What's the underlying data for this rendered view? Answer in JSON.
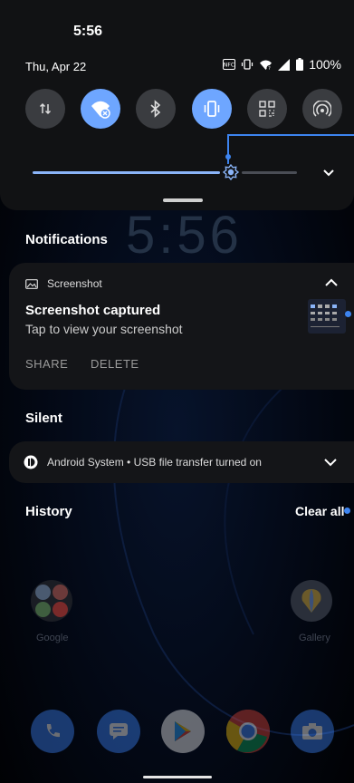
{
  "status": {
    "time": "5:56",
    "date": "Thu, Apr 22",
    "battery": "100%",
    "icons": [
      "nfc-icon",
      "vibrate-icon",
      "wifi-icon",
      "signal-icon",
      "battery-icon"
    ]
  },
  "quick_settings": {
    "tiles": [
      {
        "name": "tile-data",
        "icon": "data-arrows-icon",
        "active": false
      },
      {
        "name": "tile-wifi",
        "icon": "wifi-off-icon",
        "active": true
      },
      {
        "name": "tile-bluetooth",
        "icon": "bluetooth-icon",
        "active": false
      },
      {
        "name": "tile-vibrate",
        "icon": "vibrate-icon",
        "active": true
      },
      {
        "name": "tile-qr",
        "icon": "qr-code-icon",
        "active": false
      },
      {
        "name": "tile-hotspot",
        "icon": "hotspot-icon",
        "active": false
      }
    ],
    "brightness": 0.75
  },
  "background": {
    "clock": "5:56"
  },
  "notifications": {
    "header": "Notifications",
    "screenshot": {
      "app": "Screenshot",
      "title": "Screenshot captured",
      "text": "Tap to view your screenshot",
      "actions": [
        "SHARE",
        "DELETE"
      ]
    },
    "silent_header": "Silent",
    "android": {
      "text": "Android System • USB file transfer turned on"
    },
    "history_header": "History",
    "clear_all": "Clear all"
  },
  "home": {
    "apps": [
      {
        "label": "Google"
      },
      {
        "label": "Gallery"
      }
    ],
    "dock": [
      "phone-icon",
      "messages-icon",
      "play-store-icon",
      "chrome-icon",
      "camera-icon"
    ]
  },
  "colors": {
    "accent": "#6ea6ff",
    "shade": "#111214",
    "card": "#141518",
    "dot": "#3d84f0"
  }
}
